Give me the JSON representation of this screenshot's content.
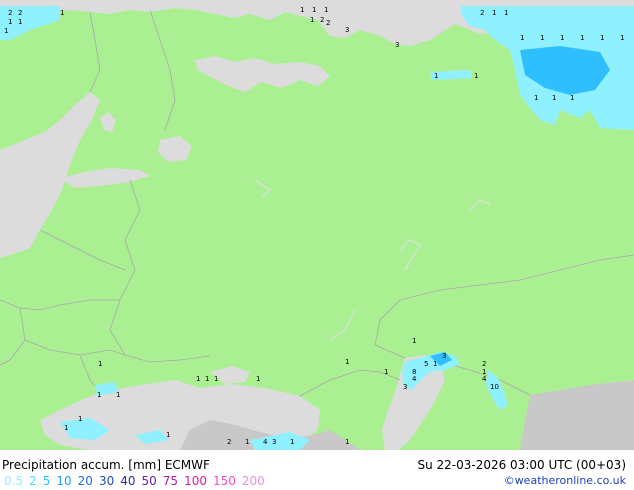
{
  "header": {
    "title": "Precipitation accum. [mm] ECMWF",
    "datetime": "Su 22-03-2026 03:00 UTC (00+03)",
    "credit": "©weatheronline.co.uk"
  },
  "legend": {
    "levels": [
      {
        "label": "0.5",
        "color": "#8ff0ff"
      },
      {
        "label": "2",
        "color": "#5ad8ff"
      },
      {
        "label": "5",
        "color": "#2fbfff"
      },
      {
        "label": "10",
        "color": "#1f9fff"
      },
      {
        "label": "20",
        "color": "#1a6fe0"
      },
      {
        "label": "30",
        "color": "#1c4fc0"
      },
      {
        "label": "40",
        "color": "#2a2fa0"
      },
      {
        "label": "50",
        "color": "#6a1fa0"
      },
      {
        "label": "75",
        "color": "#b01fb0"
      },
      {
        "label": "100",
        "color": "#e01fa0"
      },
      {
        "label": "150",
        "color": "#f04fc0"
      },
      {
        "label": "200",
        "color": "#f08fd8"
      }
    ]
  },
  "colors": {
    "land": "#aaf093",
    "sea": "#dcdcdc",
    "outside_land": "#c8c8c8",
    "border": "#a8a8a8",
    "precip_light": "#8ff0ff",
    "precip_medium": "#2fbfff"
  },
  "map": {
    "labels": [
      {
        "text": "2"
      },
      {
        "text": "2"
      },
      {
        "text": "1"
      },
      {
        "text": "1"
      },
      {
        "text": "1"
      },
      {
        "text": "1"
      },
      {
        "text": "1"
      },
      {
        "text": "1"
      },
      {
        "text": "1"
      },
      {
        "text": "1"
      },
      {
        "text": "2"
      },
      {
        "text": "2"
      },
      {
        "text": "3"
      },
      {
        "text": "3"
      },
      {
        "text": "2"
      },
      {
        "text": "1"
      },
      {
        "text": "1"
      },
      {
        "text": "1"
      },
      {
        "text": "1"
      },
      {
        "text": "1"
      },
      {
        "text": "1"
      },
      {
        "text": "1"
      },
      {
        "text": "1"
      },
      {
        "text": "1"
      },
      {
        "text": "1"
      },
      {
        "text": "1"
      },
      {
        "text": "1"
      },
      {
        "text": "1"
      },
      {
        "text": "1"
      },
      {
        "text": "8"
      },
      {
        "text": "4"
      },
      {
        "text": "3"
      },
      {
        "text": "1"
      },
      {
        "text": "5"
      },
      {
        "text": "1"
      },
      {
        "text": "3"
      },
      {
        "text": "2"
      },
      {
        "text": "1"
      },
      {
        "text": "4"
      },
      {
        "text": "10"
      },
      {
        "text": "1"
      },
      {
        "text": "1"
      },
      {
        "text": "1"
      },
      {
        "text": "1"
      },
      {
        "text": "1"
      },
      {
        "text": "1"
      },
      {
        "text": "1"
      },
      {
        "text": "1"
      },
      {
        "text": "1"
      },
      {
        "text": "1"
      },
      {
        "text": "2"
      },
      {
        "text": "1"
      },
      {
        "text": "4"
      },
      {
        "text": "3"
      },
      {
        "text": "1"
      },
      {
        "text": "1"
      },
      {
        "text": "1"
      }
    ]
  }
}
